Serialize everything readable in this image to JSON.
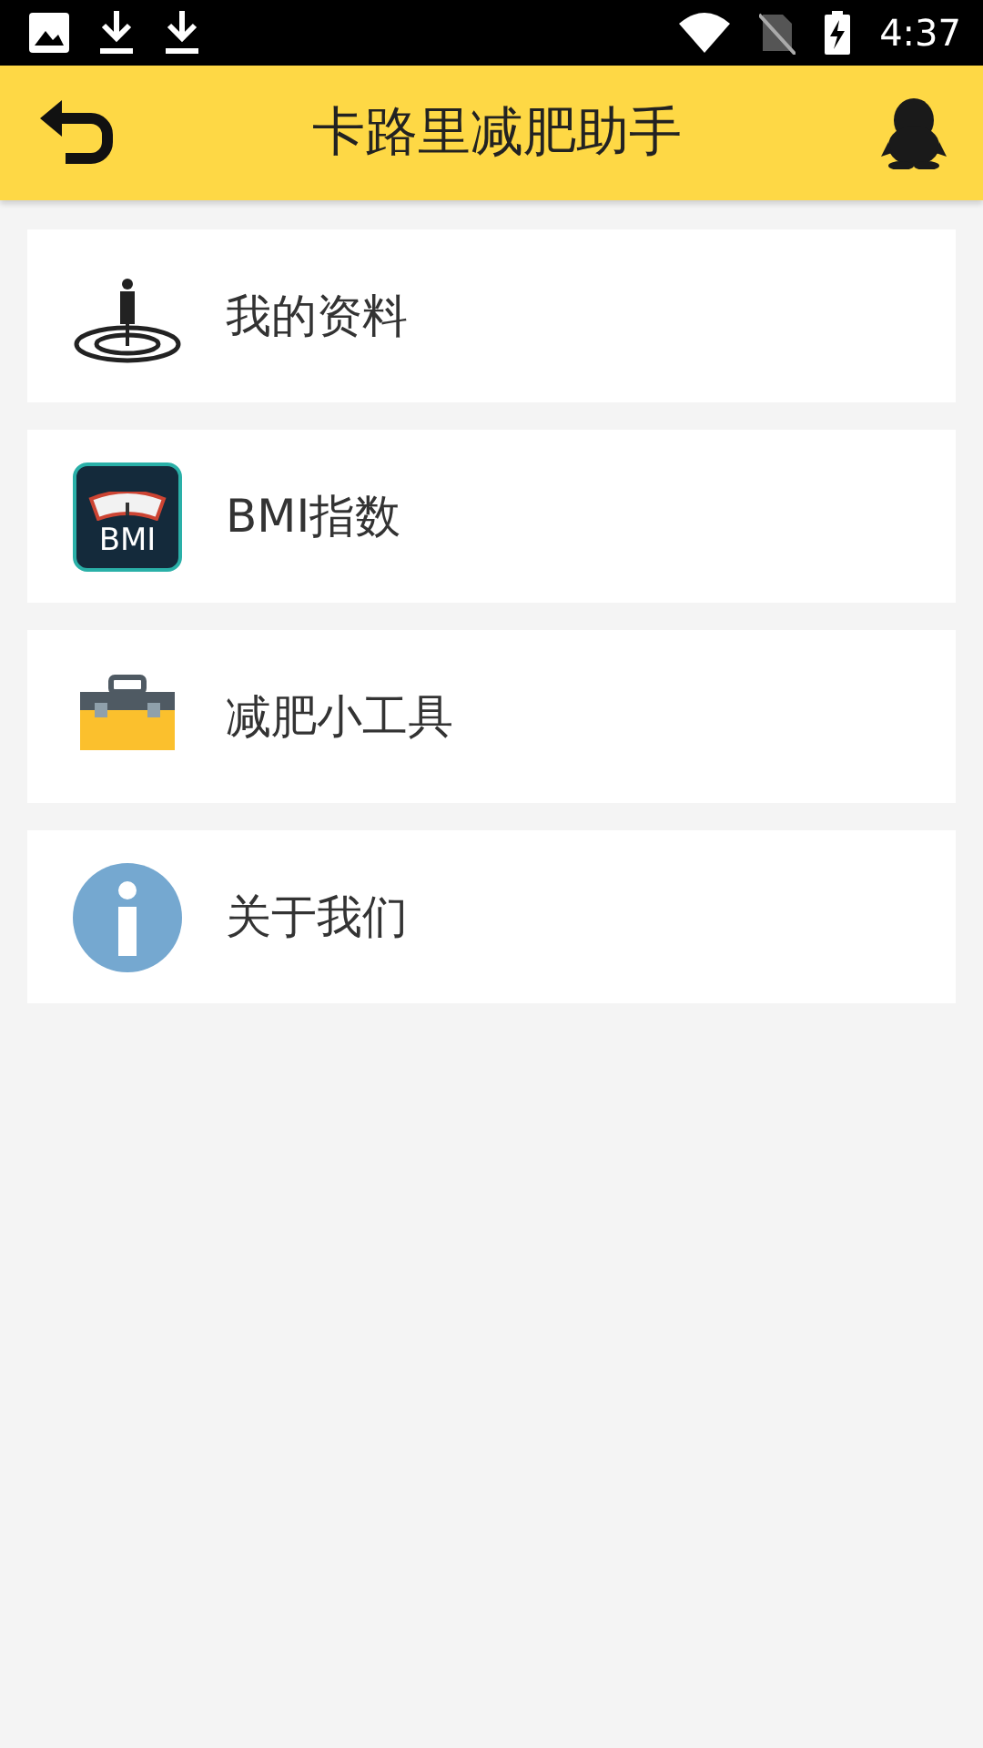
{
  "status_bar": {
    "time": "4:37"
  },
  "header": {
    "title": "卡路里减肥助手"
  },
  "menu": [
    {
      "kind": "profile",
      "label": "我的资料"
    },
    {
      "kind": "bmi",
      "label": "BMI指数",
      "icon_text": "BMI"
    },
    {
      "kind": "tools",
      "label": "减肥小工具"
    },
    {
      "kind": "about",
      "label": "关于我们"
    }
  ]
}
